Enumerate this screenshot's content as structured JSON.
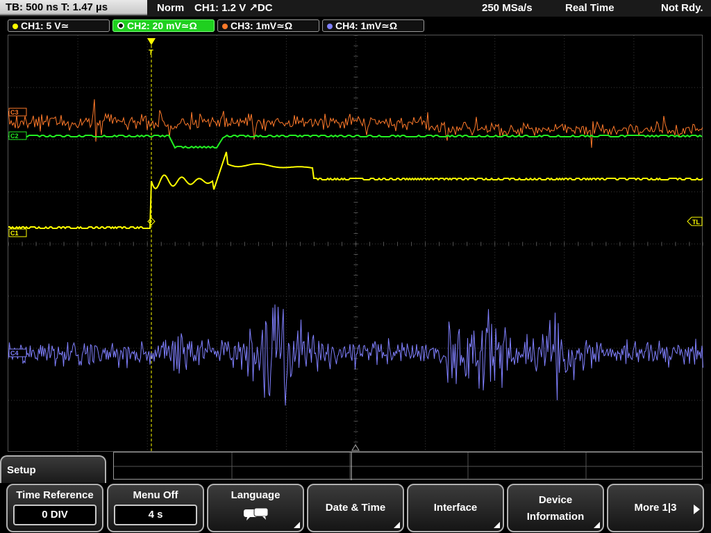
{
  "header": {
    "timebase": "TB: 500 ns   T: 1.47 µs",
    "trigger_mode": "Norm",
    "trigger_info": "CH1: 1.2 V ↗DC",
    "sample_rate": "250 MSa/s",
    "acq_mode": "Real Time",
    "status": "Not Rdy."
  },
  "channels": [
    {
      "label": "CH1: 5 V≃",
      "color": "#ffff00",
      "active": false
    },
    {
      "label": "CH2: 20 mV≃Ω",
      "color": "#22ee22",
      "active": true
    },
    {
      "label": "CH3: 1mV≃Ω",
      "color": "#ff7a2a",
      "active": false
    },
    {
      "label": "CH4: 1mV≃Ω",
      "color": "#8080ff",
      "active": false
    }
  ],
  "screen": {
    "trigger_marker": "T",
    "trigger_level_label": "TL",
    "ch1_ref_label": "C1",
    "ch2_ref_label": "C2",
    "ch3_ref_label": "C3",
    "ch4_ref_label": "C4"
  },
  "menu": {
    "title": "Setup",
    "softkeys": [
      {
        "label": "Time Reference",
        "value": "0 DIV"
      },
      {
        "label": "Menu Off",
        "value": "4 s"
      },
      {
        "label": "Language",
        "icon": "speech-bubbles-icon"
      },
      {
        "label": "Date & Time"
      },
      {
        "label": "Interface"
      },
      {
        "label": "Device Information",
        "label_line1": "Device",
        "label_line2": "Information"
      },
      {
        "label": "More 1|3"
      }
    ]
  }
}
